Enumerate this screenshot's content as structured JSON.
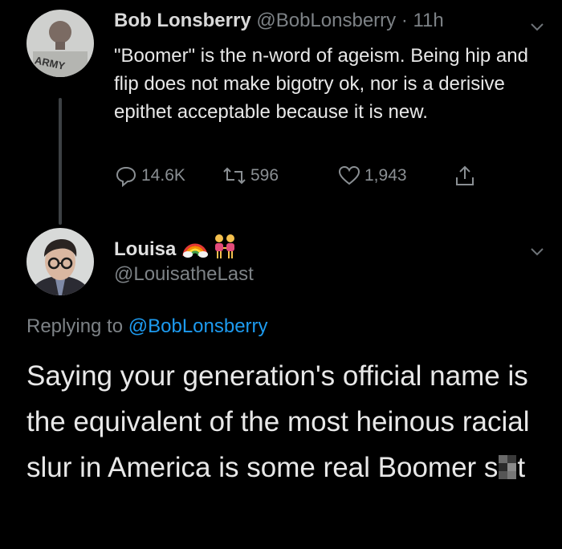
{
  "tweet1": {
    "name": "Bob Lonsberry",
    "handle": "@BobLonsberry",
    "time": "· 11h",
    "avatar_text": "ARMY",
    "body": "\"Boomer\" is the n-word of ageism. Being hip and flip does not make bigotry ok, nor is a derisive epithet acceptable because it is new.",
    "stats": {
      "replies": "14.6K",
      "retweets": "596",
      "likes": "1,943"
    }
  },
  "tweet2": {
    "name": "Louisa",
    "name_emojis": [
      "rainbow-icon",
      "two-women-holding-hands-icon"
    ],
    "handle": "@LouisatheLast",
    "replying_prefix": "Replying to",
    "replying_handle": "@BobLonsberry",
    "body_main": "Saying your generation's official name is the equivalent of the most heinous racial slur in America is some real Boomer s",
    "body_tail": "t"
  },
  "colors": {
    "background": "#000000",
    "text": "#e8e8e8",
    "muted": "#7d8286",
    "link": "#1d9bf0",
    "thread_line": "#3d4144"
  }
}
